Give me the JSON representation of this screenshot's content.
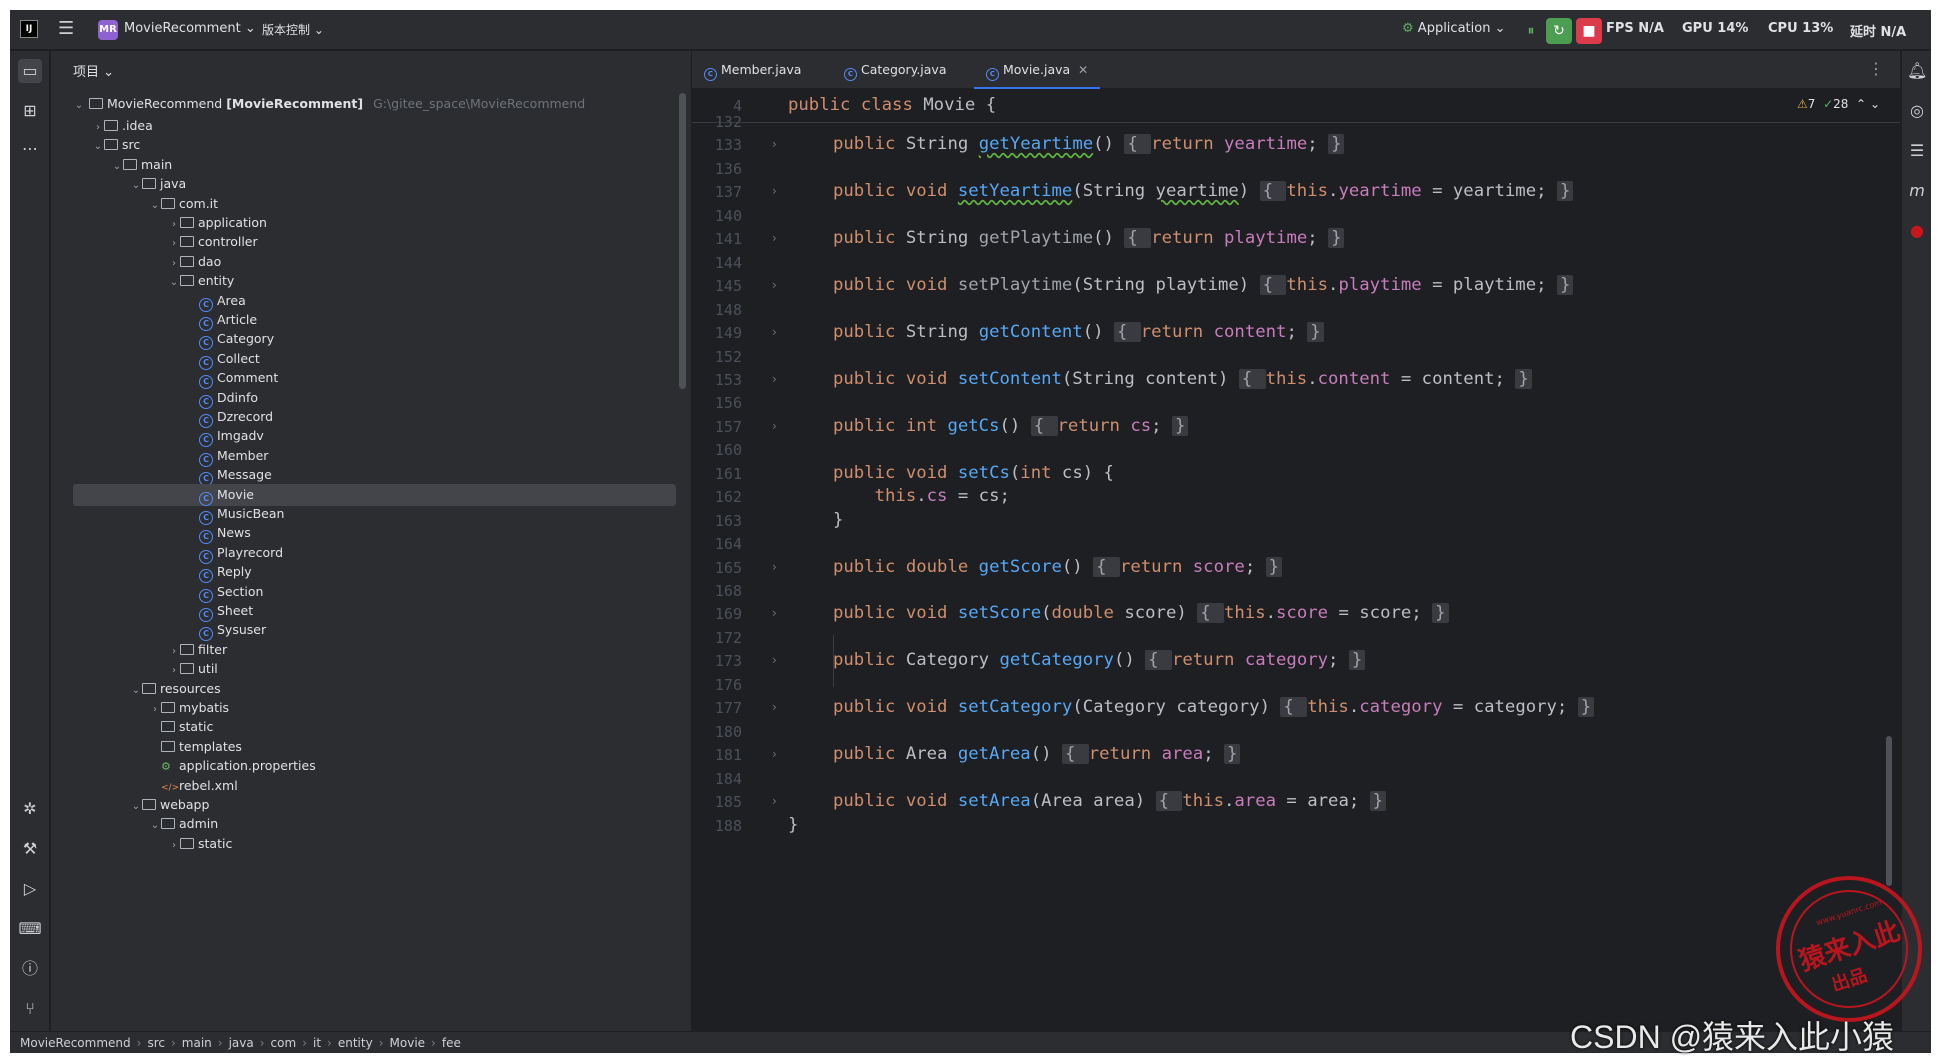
{
  "titlebar": {
    "app_logo": "IJ",
    "project_badge": "MR",
    "project_name": "MovieRecomment",
    "vcs_label": "版本控制",
    "run_config": "Application",
    "fps": "FPS N/A",
    "gpu": "GPU 14%",
    "cpu": "CPU 13%",
    "time": "延时 N/A"
  },
  "project_panel": {
    "header": "项目",
    "root_name": "MovieRecommend",
    "root_module": "[MovieRecomment]",
    "root_path": "G:\\gitee_space\\MovieRecommend",
    "tree": [
      {
        "label": ".idea",
        "depth": 1,
        "kind": "folder",
        "arrow": "›"
      },
      {
        "label": "src",
        "depth": 1,
        "kind": "folder",
        "arrow": "⌄"
      },
      {
        "label": "main",
        "depth": 2,
        "kind": "folder",
        "arrow": "⌄"
      },
      {
        "label": "java",
        "depth": 3,
        "kind": "folder",
        "arrow": "⌄"
      },
      {
        "label": "com.it",
        "depth": 4,
        "kind": "folder",
        "arrow": "⌄"
      },
      {
        "label": "application",
        "depth": 5,
        "kind": "folder",
        "arrow": "›"
      },
      {
        "label": "controller",
        "depth": 5,
        "kind": "folder",
        "arrow": "›"
      },
      {
        "label": "dao",
        "depth": 5,
        "kind": "folder",
        "arrow": "›"
      },
      {
        "label": "entity",
        "depth": 5,
        "kind": "folder",
        "arrow": "⌄"
      },
      {
        "label": "Area",
        "depth": 6,
        "kind": "class"
      },
      {
        "label": "Article",
        "depth": 6,
        "kind": "class"
      },
      {
        "label": "Category",
        "depth": 6,
        "kind": "class"
      },
      {
        "label": "Collect",
        "depth": 6,
        "kind": "class"
      },
      {
        "label": "Comment",
        "depth": 6,
        "kind": "class"
      },
      {
        "label": "Ddinfo",
        "depth": 6,
        "kind": "class"
      },
      {
        "label": "Dzrecord",
        "depth": 6,
        "kind": "class"
      },
      {
        "label": "Imgadv",
        "depth": 6,
        "kind": "class"
      },
      {
        "label": "Member",
        "depth": 6,
        "kind": "class"
      },
      {
        "label": "Message",
        "depth": 6,
        "kind": "class"
      },
      {
        "label": "Movie",
        "depth": 6,
        "kind": "class",
        "selected": true
      },
      {
        "label": "MusicBean",
        "depth": 6,
        "kind": "class"
      },
      {
        "label": "News",
        "depth": 6,
        "kind": "class"
      },
      {
        "label": "Playrecord",
        "depth": 6,
        "kind": "class"
      },
      {
        "label": "Reply",
        "depth": 6,
        "kind": "class"
      },
      {
        "label": "Section",
        "depth": 6,
        "kind": "class"
      },
      {
        "label": "Sheet",
        "depth": 6,
        "kind": "class"
      },
      {
        "label": "Sysuser",
        "depth": 6,
        "kind": "class"
      },
      {
        "label": "filter",
        "depth": 5,
        "kind": "folder",
        "arrow": "›"
      },
      {
        "label": "util",
        "depth": 5,
        "kind": "folder",
        "arrow": "›"
      },
      {
        "label": "resources",
        "depth": 3,
        "kind": "folder",
        "arrow": "⌄"
      },
      {
        "label": "mybatis",
        "depth": 4,
        "kind": "folder",
        "arrow": "›"
      },
      {
        "label": "static",
        "depth": 4,
        "kind": "folder"
      },
      {
        "label": "templates",
        "depth": 4,
        "kind": "folder"
      },
      {
        "label": "application.properties",
        "depth": 4,
        "kind": "props"
      },
      {
        "label": "rebel.xml",
        "depth": 4,
        "kind": "xml"
      },
      {
        "label": "webapp",
        "depth": 3,
        "kind": "folder",
        "arrow": "⌄"
      },
      {
        "label": "admin",
        "depth": 4,
        "kind": "folder",
        "arrow": "⌄"
      },
      {
        "label": "static",
        "depth": 5,
        "kind": "folder",
        "arrow": "›"
      }
    ]
  },
  "editor": {
    "tabs": [
      {
        "label": "Member.java",
        "active": false
      },
      {
        "label": "Category.java",
        "active": false
      },
      {
        "label": "Movie.java",
        "active": true
      }
    ],
    "sticky_line_number": "4",
    "sticky_code": "public class Movie {",
    "warnings": "7",
    "checks": "28",
    "lines": [
      {
        "n": "132",
        "fold": false,
        "tokens": []
      },
      {
        "n": "133",
        "fold": true,
        "tokens": [
          [
            "kw",
            "public "
          ],
          [
            "t",
            "String "
          ],
          [
            "fn sq",
            "getYeartime"
          ],
          [
            "t",
            "() "
          ],
          [
            "fb",
            "{ "
          ],
          [
            "kw",
            "return "
          ],
          [
            "fld",
            "yeartime"
          ],
          [
            "t",
            "; "
          ],
          [
            "fb",
            "}"
          ]
        ]
      },
      {
        "n": "136",
        "fold": false,
        "tokens": []
      },
      {
        "n": "137",
        "fold": true,
        "tokens": [
          [
            "kw",
            "public void "
          ],
          [
            "fn sq",
            "setYeartime"
          ],
          [
            "t",
            "(String "
          ],
          [
            "sqt",
            "yeartime"
          ],
          [
            "t",
            ") "
          ],
          [
            "fb",
            "{ "
          ],
          [
            "kw",
            "this"
          ],
          [
            "t",
            "."
          ],
          [
            "fld",
            "yeartime"
          ],
          [
            "t",
            " = yeartime; "
          ],
          [
            "fb",
            "}"
          ]
        ]
      },
      {
        "n": "140",
        "fold": false,
        "tokens": []
      },
      {
        "n": "141",
        "fold": true,
        "tokens": [
          [
            "kw",
            "public "
          ],
          [
            "t",
            "String "
          ],
          [
            "g",
            "getPlaytime"
          ],
          [
            "t",
            "() "
          ],
          [
            "fb",
            "{ "
          ],
          [
            "kw",
            "return "
          ],
          [
            "fld",
            "playtime"
          ],
          [
            "t",
            "; "
          ],
          [
            "fb",
            "}"
          ]
        ]
      },
      {
        "n": "144",
        "fold": false,
        "tokens": []
      },
      {
        "n": "145",
        "fold": true,
        "tokens": [
          [
            "kw",
            "public void "
          ],
          [
            "g",
            "setPlaytime"
          ],
          [
            "t",
            "(String playtime) "
          ],
          [
            "fb",
            "{ "
          ],
          [
            "kw",
            "this"
          ],
          [
            "t",
            "."
          ],
          [
            "fld",
            "playtime"
          ],
          [
            "t",
            " = playtime; "
          ],
          [
            "fb",
            "}"
          ]
        ]
      },
      {
        "n": "148",
        "fold": false,
        "tokens": []
      },
      {
        "n": "149",
        "fold": true,
        "tokens": [
          [
            "kw",
            "public "
          ],
          [
            "t",
            "String "
          ],
          [
            "fn",
            "getContent"
          ],
          [
            "t",
            "() "
          ],
          [
            "fb",
            "{ "
          ],
          [
            "kw",
            "return "
          ],
          [
            "fld",
            "content"
          ],
          [
            "t",
            "; "
          ],
          [
            "fb",
            "}"
          ]
        ]
      },
      {
        "n": "152",
        "fold": false,
        "tokens": []
      },
      {
        "n": "153",
        "fold": true,
        "tokens": [
          [
            "kw",
            "public void "
          ],
          [
            "fn",
            "setContent"
          ],
          [
            "t",
            "(String content) "
          ],
          [
            "fb",
            "{ "
          ],
          [
            "kw",
            "this"
          ],
          [
            "t",
            "."
          ],
          [
            "fld",
            "content"
          ],
          [
            "t",
            " = content; "
          ],
          [
            "fb",
            "}"
          ]
        ]
      },
      {
        "n": "156",
        "fold": false,
        "tokens": []
      },
      {
        "n": "157",
        "fold": true,
        "tokens": [
          [
            "kw",
            "public int "
          ],
          [
            "fn",
            "getCs"
          ],
          [
            "t",
            "() "
          ],
          [
            "fb",
            "{ "
          ],
          [
            "kw",
            "return "
          ],
          [
            "fld",
            "cs"
          ],
          [
            "t",
            "; "
          ],
          [
            "fb",
            "}"
          ]
        ]
      },
      {
        "n": "160",
        "fold": false,
        "tokens": []
      },
      {
        "n": "161",
        "fold": false,
        "tokens": [
          [
            "kw",
            "public void "
          ],
          [
            "fn",
            "setCs"
          ],
          [
            "t",
            "("
          ],
          [
            "kw",
            "int "
          ],
          [
            "t",
            "cs) {"
          ]
        ]
      },
      {
        "n": "162",
        "fold": false,
        "tokens": [
          [
            "t",
            "    "
          ],
          [
            "kw",
            "this"
          ],
          [
            "t",
            "."
          ],
          [
            "fld",
            "cs"
          ],
          [
            "t",
            " = cs;"
          ]
        ]
      },
      {
        "n": "163",
        "fold": false,
        "tokens": [
          [
            "t",
            "}"
          ]
        ]
      },
      {
        "n": "164",
        "fold": false,
        "tokens": []
      },
      {
        "n": "165",
        "fold": true,
        "tokens": [
          [
            "kw",
            "public double "
          ],
          [
            "fn",
            "getScore"
          ],
          [
            "t",
            "() "
          ],
          [
            "fb",
            "{ "
          ],
          [
            "kw",
            "return "
          ],
          [
            "fld",
            "score"
          ],
          [
            "t",
            "; "
          ],
          [
            "fb",
            "}"
          ]
        ]
      },
      {
        "n": "168",
        "fold": false,
        "tokens": []
      },
      {
        "n": "169",
        "fold": true,
        "tokens": [
          [
            "kw",
            "public void "
          ],
          [
            "fn",
            "setScore"
          ],
          [
            "t",
            "("
          ],
          [
            "kw",
            "double "
          ],
          [
            "t",
            "score) "
          ],
          [
            "fb",
            "{ "
          ],
          [
            "kw",
            "this"
          ],
          [
            "t",
            "."
          ],
          [
            "fld",
            "score"
          ],
          [
            "t",
            " = score; "
          ],
          [
            "fb",
            "}"
          ]
        ]
      },
      {
        "n": "172",
        "fold": false,
        "tokens": []
      },
      {
        "n": "173",
        "fold": true,
        "tokens": [
          [
            "kw",
            "public "
          ],
          [
            "t",
            "Category "
          ],
          [
            "fn",
            "getCategory"
          ],
          [
            "t",
            "() "
          ],
          [
            "fb",
            "{ "
          ],
          [
            "kw",
            "return "
          ],
          [
            "fld",
            "category"
          ],
          [
            "t",
            "; "
          ],
          [
            "fb",
            "}"
          ]
        ]
      },
      {
        "n": "176",
        "fold": false,
        "tokens": []
      },
      {
        "n": "177",
        "fold": true,
        "tokens": [
          [
            "kw",
            "public void "
          ],
          [
            "fn",
            "setCategory"
          ],
          [
            "t",
            "(Category category) "
          ],
          [
            "fb",
            "{ "
          ],
          [
            "kw",
            "this"
          ],
          [
            "t",
            "."
          ],
          [
            "fld",
            "category"
          ],
          [
            "t",
            " = category; "
          ],
          [
            "fb",
            "}"
          ]
        ]
      },
      {
        "n": "180",
        "fold": false,
        "tokens": []
      },
      {
        "n": "181",
        "fold": true,
        "tokens": [
          [
            "kw",
            "public "
          ],
          [
            "t",
            "Area "
          ],
          [
            "fn",
            "getArea"
          ],
          [
            "t",
            "() "
          ],
          [
            "fb",
            "{ "
          ],
          [
            "kw",
            "return "
          ],
          [
            "fld",
            "area"
          ],
          [
            "t",
            "; "
          ],
          [
            "fb",
            "}"
          ]
        ]
      },
      {
        "n": "184",
        "fold": false,
        "tokens": []
      },
      {
        "n": "185",
        "fold": true,
        "tokens": [
          [
            "kw",
            "public void "
          ],
          [
            "fn",
            "setArea"
          ],
          [
            "t",
            "(Area area) "
          ],
          [
            "fb",
            "{ "
          ],
          [
            "kw",
            "this"
          ],
          [
            "t",
            "."
          ],
          [
            "fld",
            "area"
          ],
          [
            "t",
            " = area; "
          ],
          [
            "fb",
            "}"
          ]
        ]
      },
      {
        "n": "188",
        "fold": false,
        "tokens": [
          [
            "t",
            "}"
          ]
        ]
      }
    ]
  },
  "statusbar": {
    "breadcrumbs": [
      "MovieRecommend",
      "src",
      "main",
      "java",
      "com",
      "it",
      "entity",
      "Movie",
      "fee"
    ]
  },
  "watermark": {
    "stamp_url": "www.yuanrc.com",
    "stamp_title": "猿来入此",
    "stamp_sub": "出品",
    "csdn": "CSDN @猿来入此小猿"
  },
  "colors": {
    "keyword": "#cf8e6d",
    "function": "#56a8f5",
    "field": "#c77dbb",
    "background": "#1e1f22",
    "panel": "#2b2d30"
  }
}
